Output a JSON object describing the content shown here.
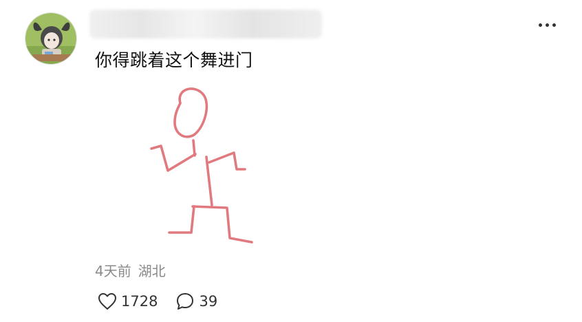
{
  "post": {
    "username": "",
    "text": "你得跳着这个舞进门",
    "time": "4天前",
    "location": "湖北",
    "likes": "1728",
    "comments": "39"
  },
  "icons": {
    "avatar": "anime-character-avatar",
    "more": "more-horizontal-icon",
    "like": "heart-outline-icon",
    "comment": "speech-bubble-icon"
  },
  "colors": {
    "drawing_stroke": "#e07a7e",
    "meta_text": "#8a8a8a",
    "body_text": "#111111"
  }
}
